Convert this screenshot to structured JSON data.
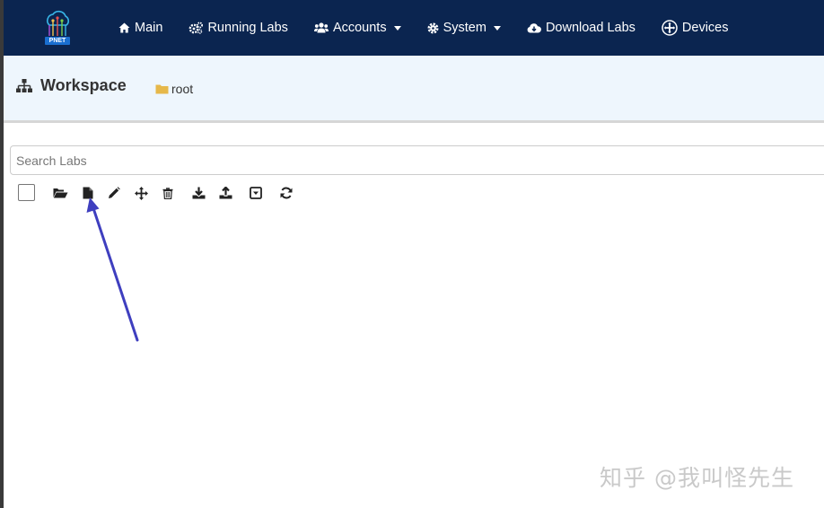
{
  "app": {
    "logo_text": "PNET"
  },
  "navbar": {
    "items": [
      {
        "label": "Main",
        "icon": "home-icon"
      },
      {
        "label": "Running Labs",
        "icon": "cogs-icon"
      },
      {
        "label": "Accounts",
        "icon": "users-icon",
        "dropdown": true
      },
      {
        "label": "System",
        "icon": "cog-icon",
        "dropdown": true
      },
      {
        "label": "Download Labs",
        "icon": "cloud-download-icon"
      },
      {
        "label": "Devices",
        "icon": "plus-circle-icon"
      }
    ]
  },
  "workspace": {
    "title": "Workspace",
    "title_icon": "sitemap-icon",
    "breadcrumb": "root",
    "breadcrumb_icon": "folder-icon"
  },
  "search": {
    "placeholder": "Search Labs",
    "value": ""
  },
  "toolbar": {
    "tools": [
      "select-all-checkbox",
      "open-folder-icon",
      "new-file-icon",
      "edit-pencil-icon",
      "move-arrows-icon",
      "delete-trash-icon",
      "download-icon",
      "upload-icon",
      "dropdown-box-icon",
      "refresh-icon"
    ]
  },
  "annotation": {
    "arrow_color": "#3f3fbf"
  },
  "watermark": {
    "text": "知乎 @我叫怪先生"
  },
  "colors": {
    "navbar_bg": "#0b2550",
    "header_bg": "#eef6fd",
    "folder_yellow": "#e6b84a"
  }
}
